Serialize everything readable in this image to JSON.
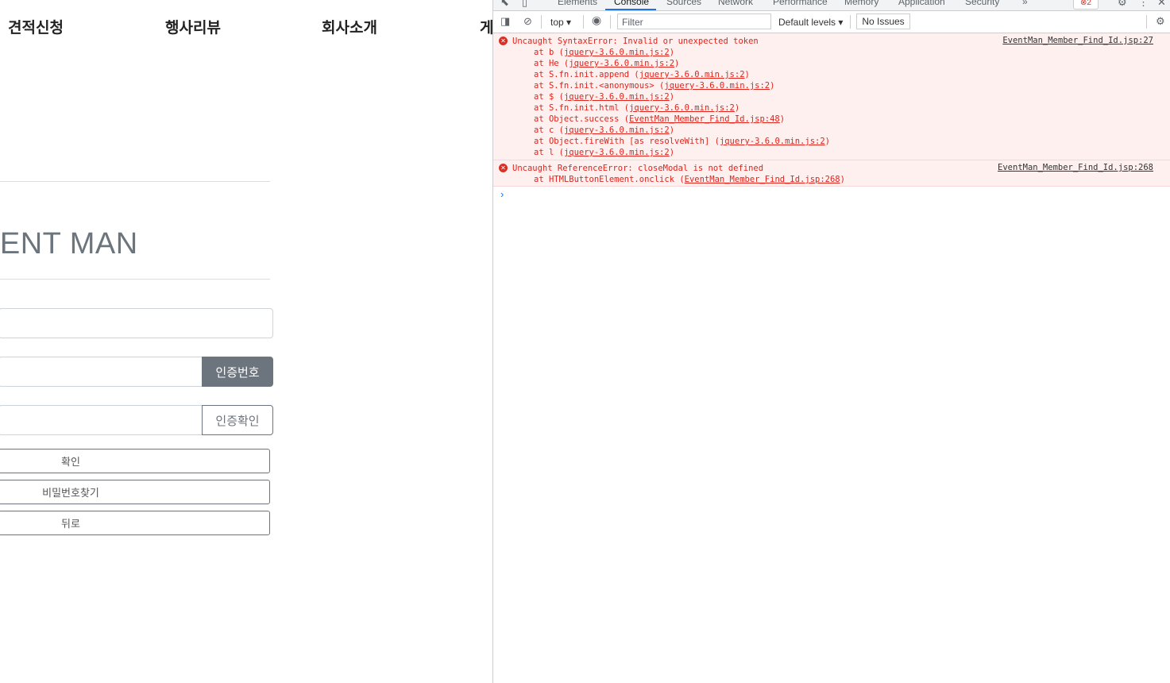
{
  "page": {
    "nav": [
      "견적신청",
      "행사리뷰",
      "회사소개",
      "게"
    ],
    "brand": "VENT MAN",
    "auth_button": "인증번호",
    "verify_button": "인증확인",
    "confirm_button": "확인",
    "find_password_button": "비밀번호찾기",
    "back_button": "뒤로"
  },
  "devtools": {
    "tabs": [
      "Elements",
      "Console",
      "Sources",
      "Network",
      "Performance",
      "Memory",
      "Application",
      "Security"
    ],
    "more_tabs": "»",
    "error_count": "2",
    "context": "top",
    "filter_placeholder": "Filter",
    "levels": "Default levels",
    "issues": "No Issues",
    "errors": [
      {
        "message": "Uncaught SyntaxError: Invalid or unexpected token",
        "source": "EventMan_Member_Find_Id.jsp:27",
        "stack": [
          {
            "prefix": "at b (",
            "link": "jquery-3.6.0.min.js:2",
            "suffix": ")"
          },
          {
            "prefix": "at He (",
            "link": "jquery-3.6.0.min.js:2",
            "suffix": ")"
          },
          {
            "prefix": "at S.fn.init.append (",
            "link": "jquery-3.6.0.min.js:2",
            "suffix": ")"
          },
          {
            "prefix": "at S.fn.init.<anonymous> (",
            "link": "jquery-3.6.0.min.js:2",
            "suffix": ")"
          },
          {
            "prefix": "at $ (",
            "link": "jquery-3.6.0.min.js:2",
            "suffix": ")"
          },
          {
            "prefix": "at S.fn.init.html (",
            "link": "jquery-3.6.0.min.js:2",
            "suffix": ")"
          },
          {
            "prefix": "at Object.success (",
            "link": "EventMan_Member_Find_Id.jsp:48",
            "suffix": ")"
          },
          {
            "prefix": "at c (",
            "link": "jquery-3.6.0.min.js:2",
            "suffix": ")"
          },
          {
            "prefix": "at Object.fireWith [as resolveWith] (",
            "link": "jquery-3.6.0.min.js:2",
            "suffix": ")"
          },
          {
            "prefix": "at l (",
            "link": "jquery-3.6.0.min.js:2",
            "suffix": ")"
          }
        ]
      },
      {
        "message": "Uncaught ReferenceError: closeModal is not defined",
        "source": "EventMan_Member_Find_Id.jsp:268",
        "stack": [
          {
            "prefix": "at HTMLButtonElement.onclick (",
            "link": "EventMan_Member_Find_Id.jsp:268",
            "suffix": ")"
          }
        ]
      }
    ],
    "prompt_symbol": "›"
  }
}
